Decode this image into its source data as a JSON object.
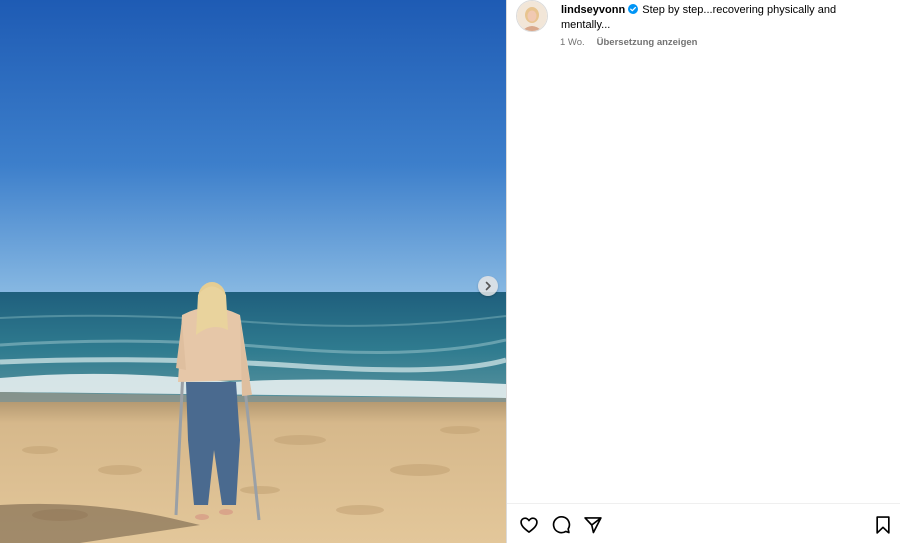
{
  "post": {
    "image_alt": "Woman on crutches walking barefoot on a sandy beach toward the ocean under a clear blue sky",
    "carousel_next_icon": "chevron-right-icon"
  },
  "caption": {
    "username": "lindseyvonn",
    "verified": true,
    "text": "Step by step...recovering physically and mentally...",
    "time_ago": "1 Wo.",
    "translate_label": "Übersetzung anzeigen"
  },
  "actions": {
    "icons": [
      "heart-icon",
      "comment-icon",
      "share-icon",
      "bookmark-icon"
    ]
  },
  "colors": {
    "verified_blue": "#0095f6",
    "meta_gray": "#737373",
    "sky_top": "#1f5db6",
    "sky_horizon": "#7fb2df",
    "sea": "#2a6e86",
    "sand": "#d9ba8c"
  }
}
